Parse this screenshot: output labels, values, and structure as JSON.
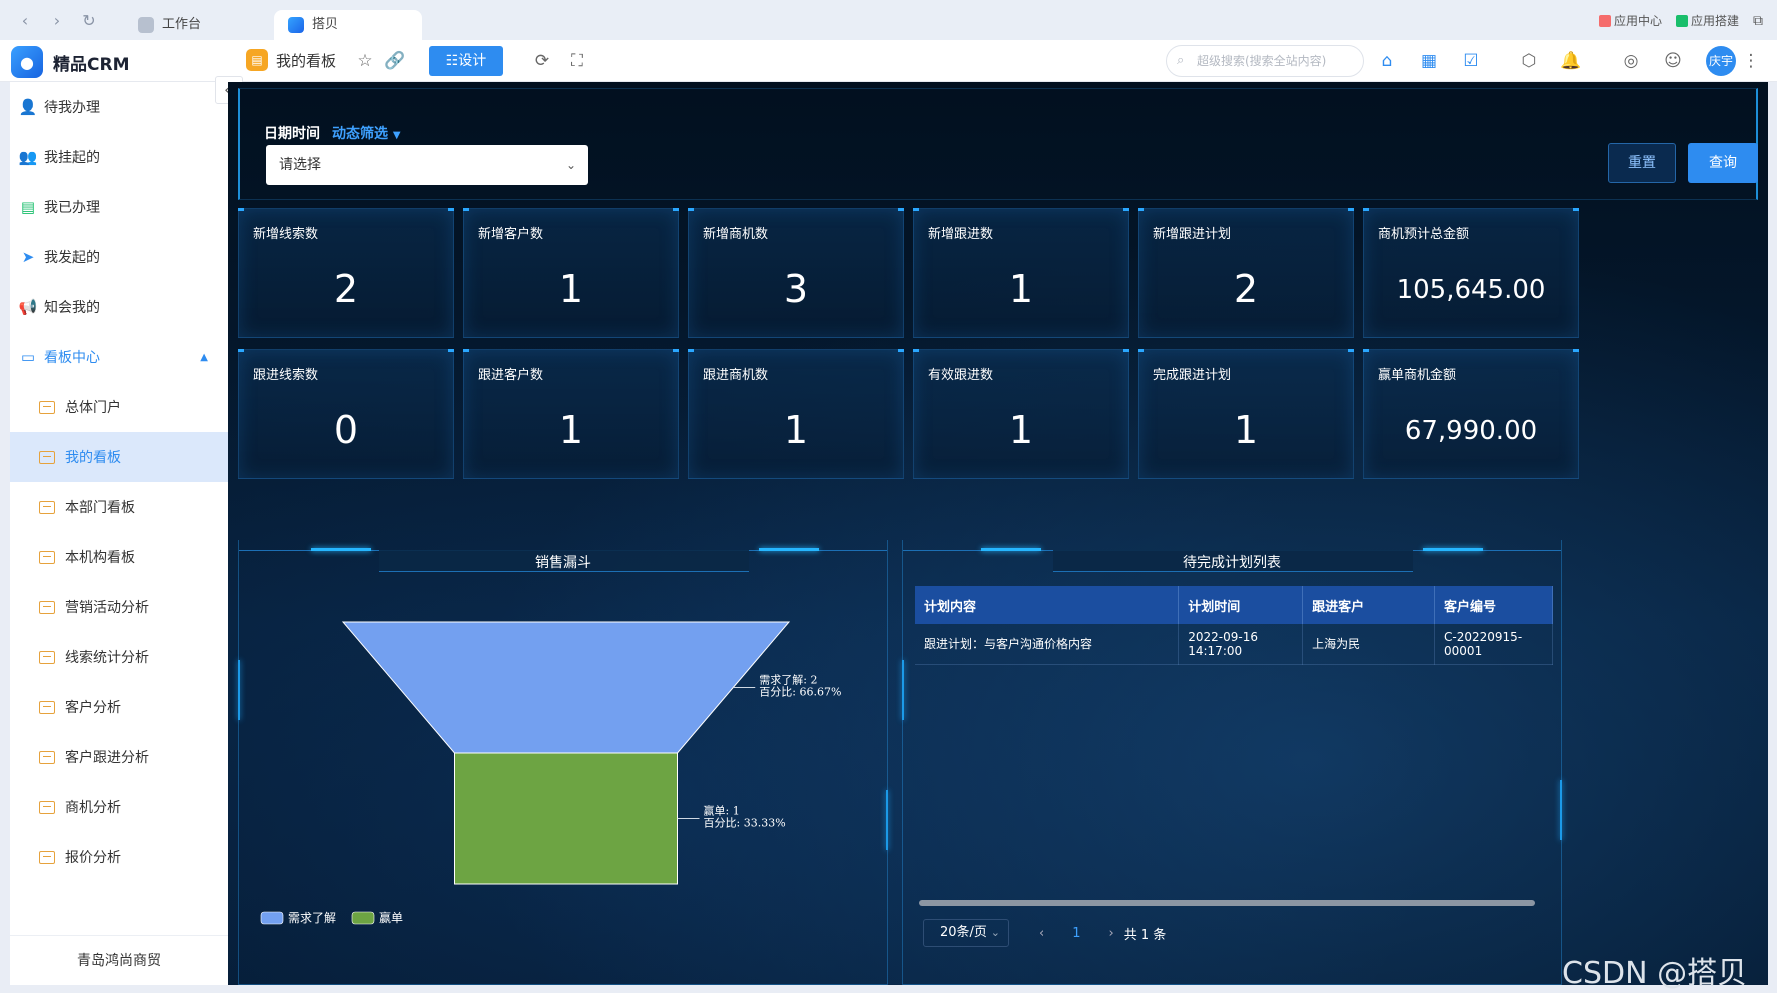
{
  "browser": {
    "tabs": [
      {
        "label": "工作台",
        "active": false
      },
      {
        "label": "搭贝",
        "active": true
      }
    ],
    "right_links": [
      "应用中心",
      "应用搭建"
    ]
  },
  "toolbar": {
    "app_name": "精品CRM",
    "board_title": "我的看板",
    "design_label": "☷设计",
    "search_placeholder": "超级搜索(搜索全站内容)",
    "avatar_text": "庆宇"
  },
  "sidebar": {
    "items": [
      {
        "label": "待我办理",
        "icon": "user-icon",
        "color": "#2e8cf0"
      },
      {
        "label": "我挂起的",
        "icon": "users-icon",
        "color": "#2e8cf0"
      },
      {
        "label": "我已办理",
        "icon": "checklist-icon",
        "color": "#19be6b"
      },
      {
        "label": "我发起的",
        "icon": "send-icon",
        "color": "#2e8cf0"
      },
      {
        "label": "知会我的",
        "icon": "megaphone-icon",
        "color": "#f5a623"
      }
    ],
    "group": {
      "label": "看板中心",
      "icon": "dashboard-icon",
      "expanded": true
    },
    "sub_items": [
      {
        "label": "总体门户",
        "active": false
      },
      {
        "label": "我的看板",
        "active": true
      },
      {
        "label": "本部门看板",
        "active": false
      },
      {
        "label": "本机构看板",
        "active": false
      },
      {
        "label": "营销活动分析",
        "active": false
      },
      {
        "label": "线索统计分析",
        "active": false
      },
      {
        "label": "客户分析",
        "active": false
      },
      {
        "label": "客户跟进分析",
        "active": false
      },
      {
        "label": "商机分析",
        "active": false
      },
      {
        "label": "报价分析",
        "active": false
      }
    ],
    "footer": "青岛鸿尚商贸"
  },
  "filter": {
    "label": "日期时间",
    "dynamic_label": "动态筛选",
    "select_placeholder": "请选择",
    "reset_label": "重置",
    "query_label": "查询"
  },
  "kpis": [
    {
      "label": "新增线索数",
      "value": "2"
    },
    {
      "label": "新增客户数",
      "value": "1"
    },
    {
      "label": "新增商机数",
      "value": "3"
    },
    {
      "label": "新增跟进数",
      "value": "1"
    },
    {
      "label": "新增跟进计划",
      "value": "2"
    },
    {
      "label": "商机预计总金额",
      "value": "105,645.00"
    },
    {
      "label": "跟进线索数",
      "value": "0"
    },
    {
      "label": "跟进客户数",
      "value": "1"
    },
    {
      "label": "跟进商机数",
      "value": "1"
    },
    {
      "label": "有效跟进数",
      "value": "1"
    },
    {
      "label": "完成跟进计划",
      "value": "1"
    },
    {
      "label": "赢单商机金额",
      "value": "67,990.00"
    }
  ],
  "funnel_panel": {
    "title": "销售漏斗"
  },
  "chart_data": {
    "type": "funnel",
    "title": "销售漏斗",
    "categories": [
      "需求了解",
      "赢单"
    ],
    "values": [
      2,
      1
    ],
    "percentages": [
      "66.67%",
      "33.33%"
    ],
    "value_prefix": ": ",
    "percent_prefix": "百分比: ",
    "colors": [
      "#73a0f0",
      "#6da443"
    ],
    "legend": [
      "需求了解",
      "赢单"
    ],
    "legend_position": "bottom-left"
  },
  "plan_panel": {
    "title": "待完成计划列表",
    "columns": [
      "计划内容",
      "计划时间",
      "跟进客户",
      "客户编号"
    ],
    "rows": [
      [
        "跟进计划：与客户沟通价格内容",
        "2022-09-16 14:17:00",
        "上海为民",
        "C-20220915-00001"
      ]
    ],
    "page_size": "20条/页",
    "current_page": "1",
    "total": "共 1 条"
  },
  "watermark": "CSDN @搭贝"
}
